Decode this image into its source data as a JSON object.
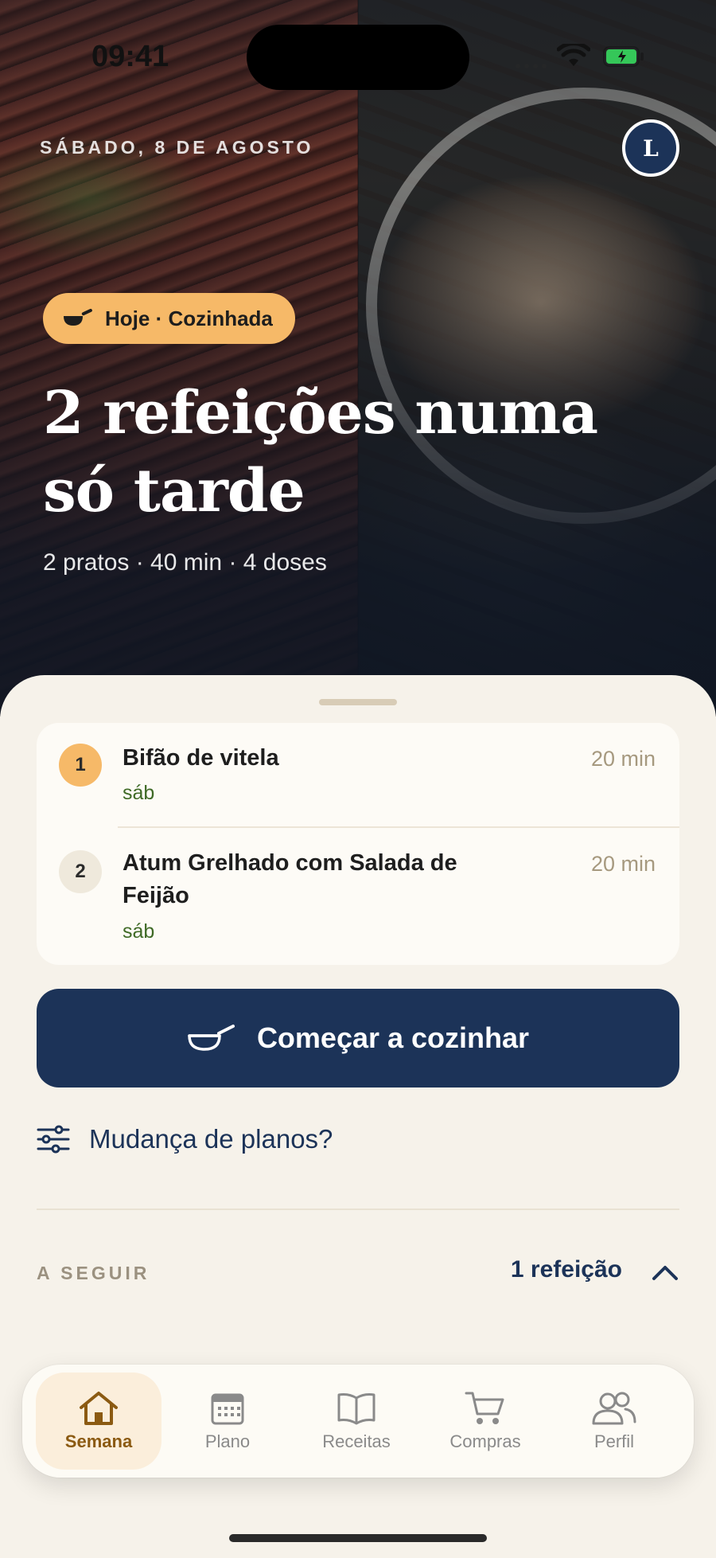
{
  "status_bar": {
    "time": "09:41"
  },
  "header": {
    "date": "SÁBADO, 8 DE AGOSTO",
    "avatar_initial": "L"
  },
  "hero": {
    "badge_label": "Hoje · Cozinhada",
    "title": "2 refeições numa só tarde",
    "meta": "2 pratos · 40 min · 4 doses"
  },
  "meals": [
    {
      "number": "1",
      "title": "Bifão de vitela",
      "day": "sáb",
      "time": "20 min"
    },
    {
      "number": "2",
      "title": "Atum Grelhado com Salada de Feijão",
      "day": "sáb",
      "time": "20 min"
    }
  ],
  "actions": {
    "start_cooking": "Começar a cozinhar",
    "change_plans": "Mudança de planos?"
  },
  "next_section": {
    "label": "A SEGUIR",
    "count": "1 refeição"
  },
  "tabbar": [
    {
      "label": "Semana",
      "icon": "home-icon"
    },
    {
      "label": "Plano",
      "icon": "calendar-icon"
    },
    {
      "label": "Receitas",
      "icon": "book-icon"
    },
    {
      "label": "Compras",
      "icon": "cart-icon"
    },
    {
      "label": "Perfil",
      "icon": "people-icon"
    }
  ],
  "colors": {
    "navy": "#1c3358",
    "accent_orange": "#f6b968",
    "background": "#f6f2ea",
    "green_text": "#3f6a26",
    "active_tab": "#8b5a12"
  }
}
